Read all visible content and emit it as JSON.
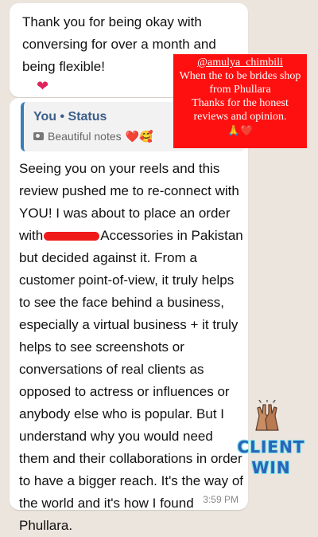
{
  "message_top": {
    "text": "Thank you for being okay with conversing for over a month and being flexible!",
    "reaction_icon": "red-heart"
  },
  "message_main": {
    "quote": {
      "title": "You • Status",
      "subtitle": "Beautiful notes",
      "subtitle_icon": "camera",
      "subtitle_emojis": "❤️🥰"
    },
    "body_part1": "Seeing you on your reels and this review pushed me to re-connect with YOU! I was about to place an order with",
    "body_part2": "Accessories in Pakistan but decided against it. From a customer point-of-view, it truly helps to see the face behind a business, especially a virtual business + it truly helps to see screenshots or conversations of real clients as opposed to actress or influences or anybody else who is popular. But I understand why you would need them and their collaborations in order to have a bigger reach. It's the way of the world and it's how I found Phullara.",
    "time": "3:59 PM"
  },
  "overlay_note": {
    "handle": "@amulya_chimbili",
    "line1": "When the to be brides shop from Phullara",
    "line2": "Thanks for the honest reviews and opinion.",
    "emojis": "🙏❤️",
    "bg_color": "#ff1010"
  },
  "sticker": {
    "icon": "high-five-hands",
    "line1": "CLIENT",
    "line2": "WIN",
    "text_color": "#2a63b8"
  }
}
